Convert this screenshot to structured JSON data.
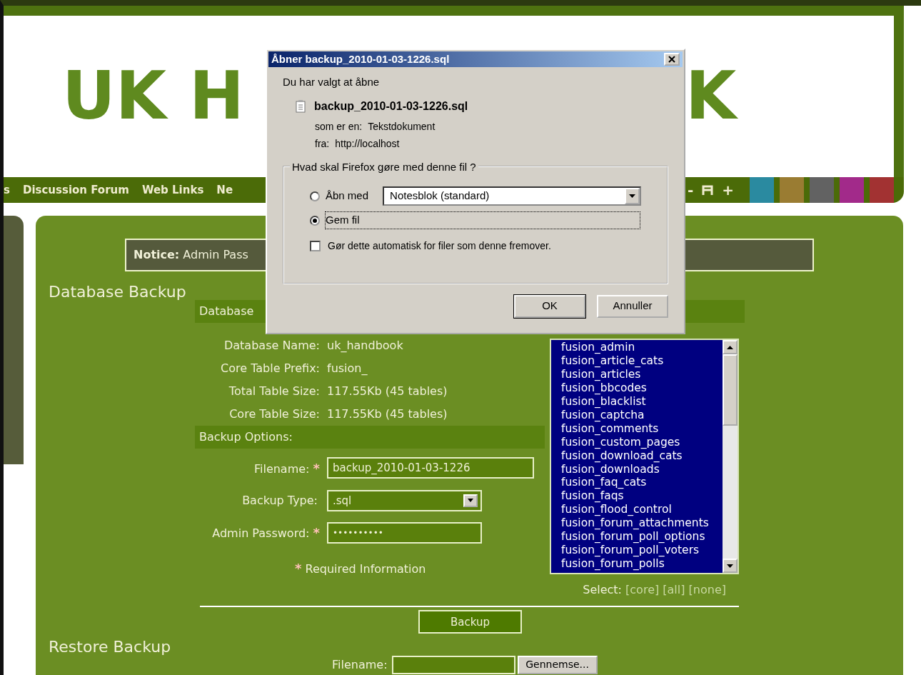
{
  "logo": {
    "parts": [
      "UK H",
      "K"
    ]
  },
  "nav": {
    "items": [
      {
        "label": "s"
      },
      {
        "label": "Discussion Forum"
      },
      {
        "label": "Web Links"
      },
      {
        "label": "Ne"
      }
    ],
    "text_controls": [
      {
        "kind": "text",
        "label": "-"
      },
      {
        "kind": "icon"
      },
      {
        "kind": "text",
        "label": "+"
      }
    ],
    "swatches": [
      {
        "color": "#2a8aa0"
      },
      {
        "color": "#9a7c32"
      },
      {
        "color": "#626262"
      },
      {
        "color": "#a22a8a"
      },
      {
        "color": "#a23232"
      }
    ]
  },
  "notice": {
    "label": "Notice:",
    "text": "Admin Pass"
  },
  "backup": {
    "title": "Database Backup",
    "info_header": "Database",
    "info_rows": [
      {
        "label": "Database Name:",
        "value": "uk_handbook"
      },
      {
        "label": "Core Table Prefix:",
        "value": "fusion_"
      },
      {
        "label": "Total Table Size:",
        "value": "117.55Kb (45 tables)"
      },
      {
        "label": "Core Table Size:",
        "value": "117.55Kb (45 tables)"
      }
    ],
    "options_header": "Backup Options:",
    "fields": [
      {
        "kind": "text",
        "label": "Filename:",
        "required": true,
        "value": "backup_2010-01-03-1226"
      },
      {
        "kind": "select",
        "label": "Backup Type:",
        "required": false,
        "value": ".sql"
      },
      {
        "kind": "password",
        "label": "Admin Password:",
        "required": true,
        "value": "••••••••••"
      }
    ],
    "required_mark": "*",
    "required_note": "Required Information",
    "tables": [
      {
        "label": "fusion_admin",
        "selected": true
      },
      {
        "label": "fusion_article_cats",
        "selected": true
      },
      {
        "label": "fusion_articles",
        "selected": true
      },
      {
        "label": "fusion_bbcodes",
        "selected": true
      },
      {
        "label": "fusion_blacklist",
        "selected": true
      },
      {
        "label": "fusion_captcha",
        "selected": true
      },
      {
        "label": "fusion_comments",
        "selected": true
      },
      {
        "label": "fusion_custom_pages",
        "selected": true
      },
      {
        "label": "fusion_download_cats",
        "selected": true
      },
      {
        "label": "fusion_downloads",
        "selected": true
      },
      {
        "label": "fusion_faq_cats",
        "selected": true
      },
      {
        "label": "fusion_faqs",
        "selected": true
      },
      {
        "label": "fusion_flood_control",
        "selected": true
      },
      {
        "label": "fusion_forum_attachments",
        "selected": true
      },
      {
        "label": "fusion_forum_poll_options",
        "selected": true
      },
      {
        "label": "fusion_forum_poll_voters",
        "selected": true
      },
      {
        "label": "fusion_forum_polls",
        "selected": true
      }
    ],
    "select_label": "Select:",
    "select_links": [
      "[core]",
      "[all]",
      "[none]"
    ],
    "button": "Backup"
  },
  "restore": {
    "title": "Restore Backup",
    "filename_label": "Filename:",
    "browse_button": "Gennemse..."
  },
  "dialog": {
    "title": "Åbner backup_2010-01-03-1226.sql",
    "intro": "Du har valgt at åbne",
    "file": "backup_2010-01-03-1226.sql",
    "type_label": "som er en:",
    "type": "Tekstdokument",
    "from_label": "fra:",
    "from": "http://localhost",
    "legend": "Hvad skal Firefox gøre med denne fil ?",
    "options": [
      {
        "label": "Åbn med",
        "selected": false
      },
      {
        "label": "Gem fil",
        "selected": true
      }
    ],
    "open_with": "Notesblok (standard)",
    "auto": {
      "label": "Gør dette automatisk for filer som denne fremover.",
      "checked": false
    },
    "buttons": [
      "OK",
      "Annuller"
    ]
  }
}
